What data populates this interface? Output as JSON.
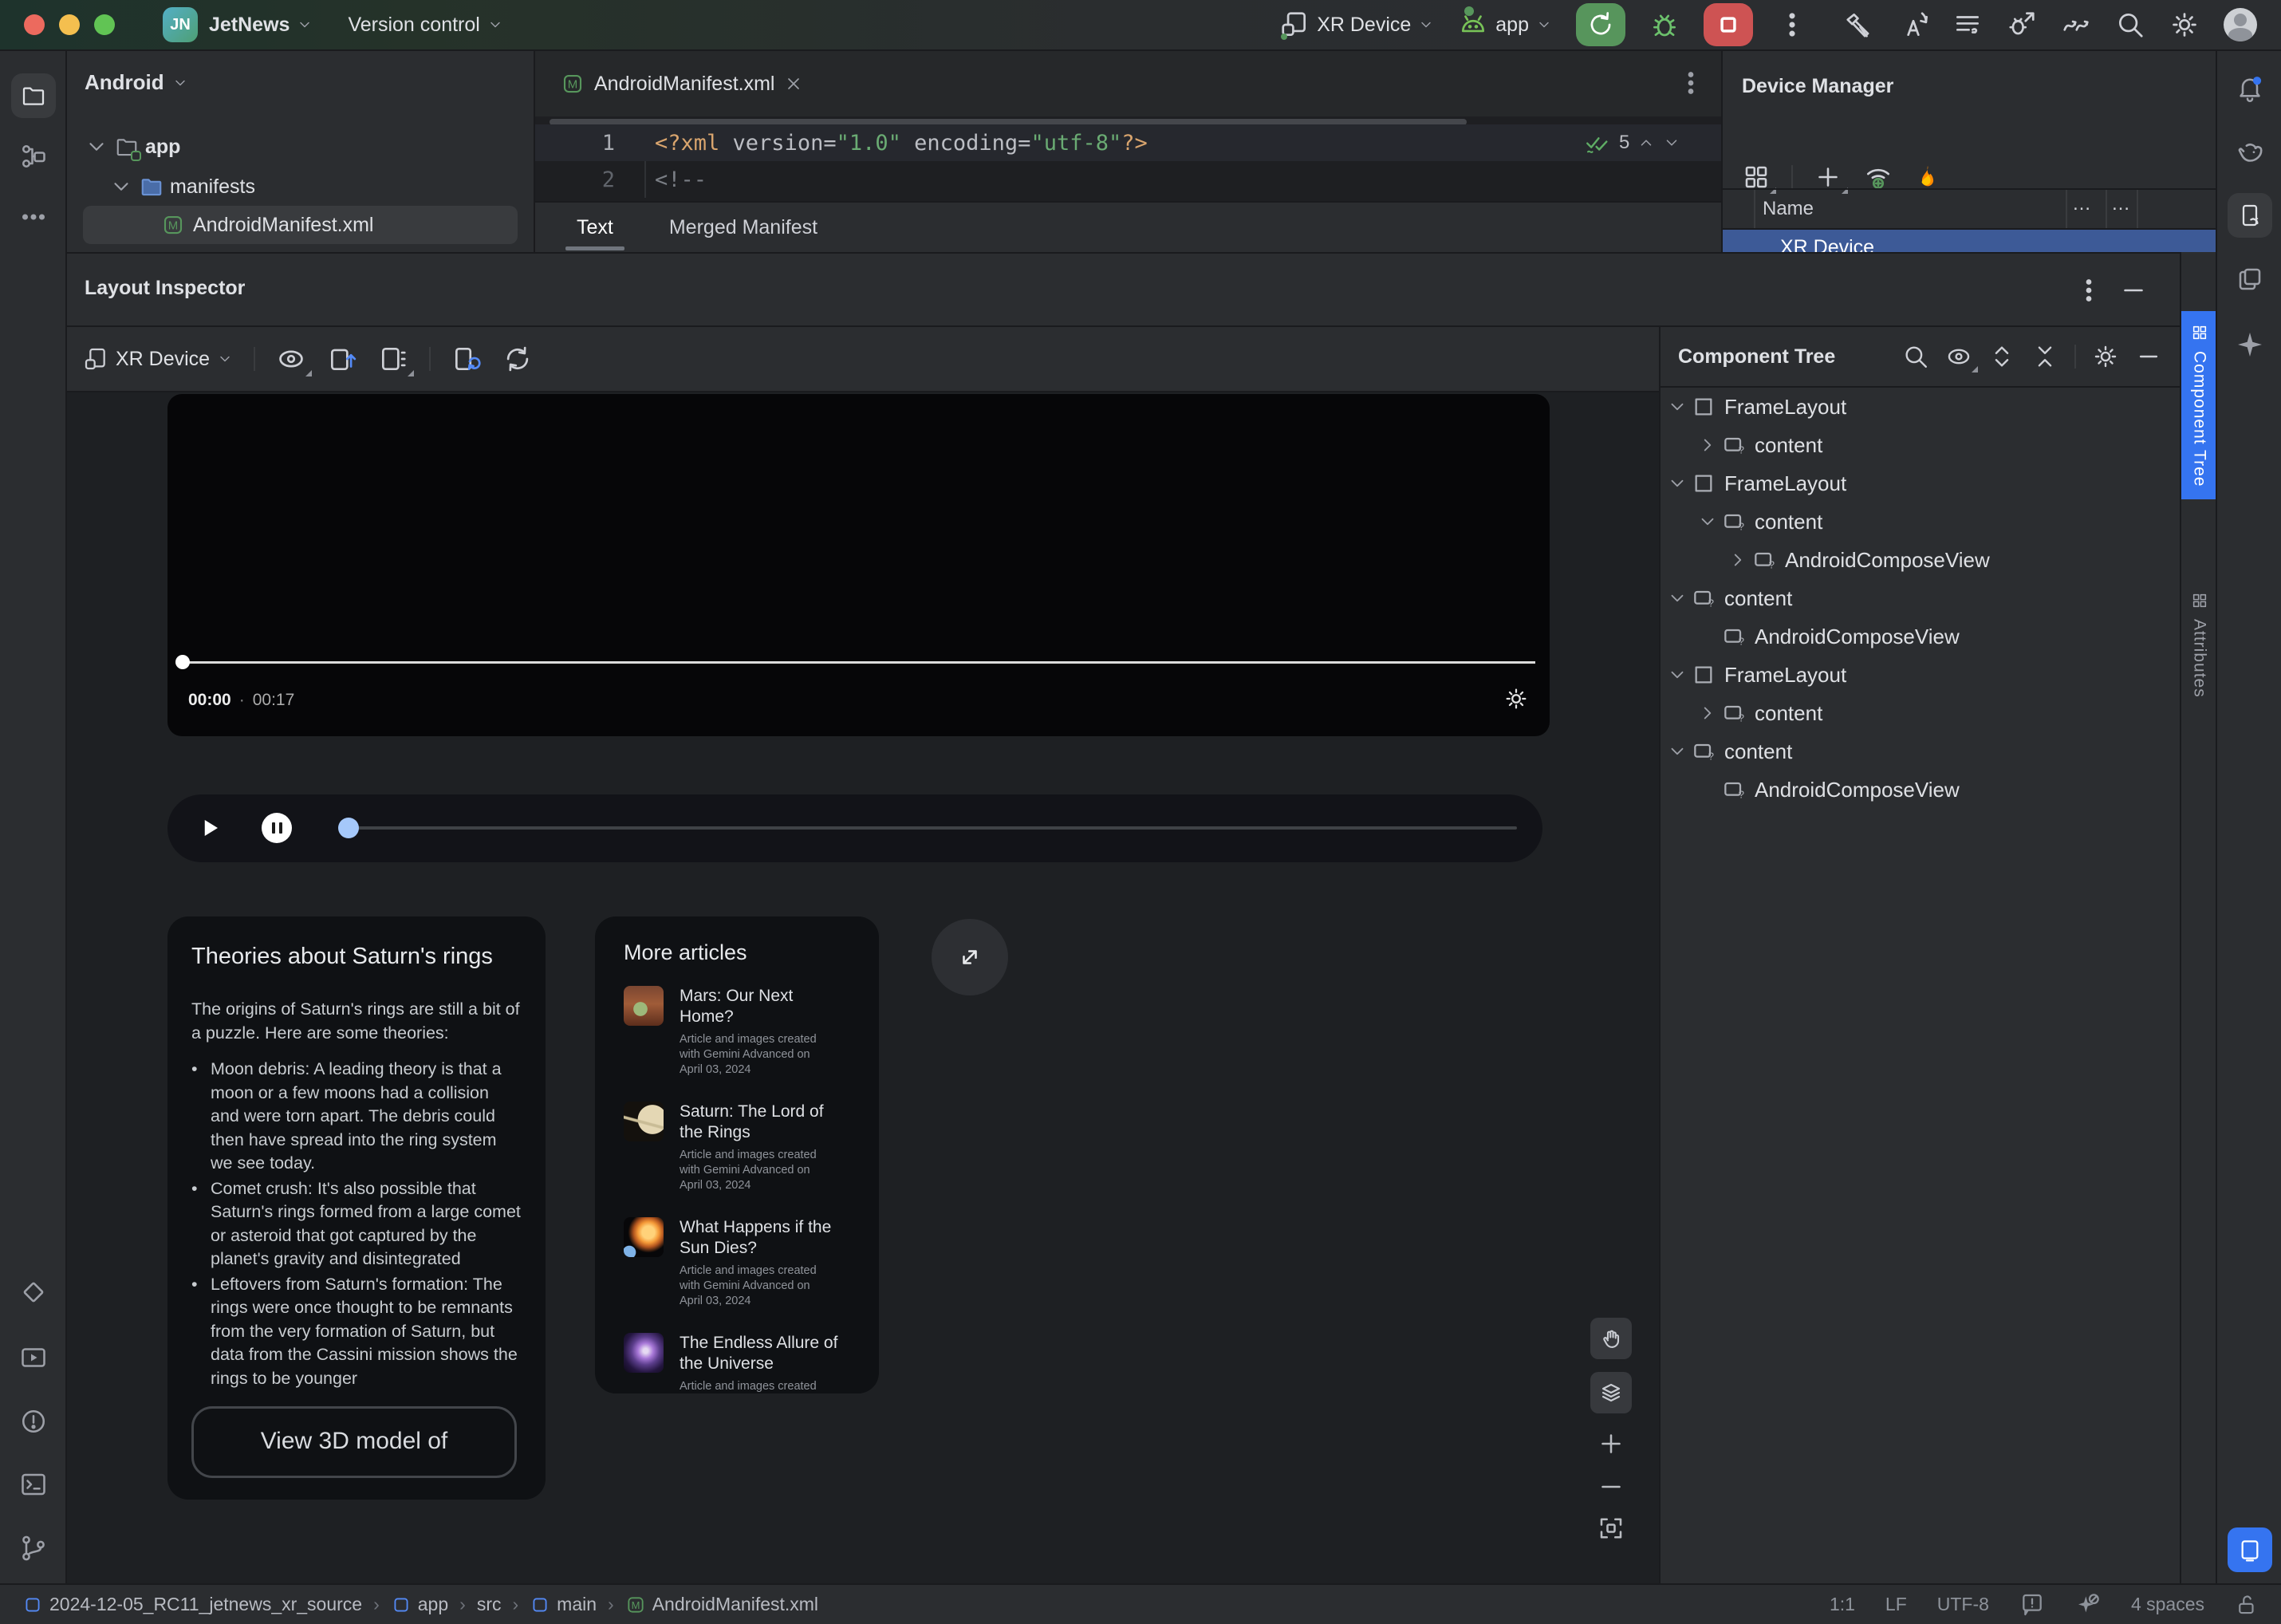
{
  "titlebar": {
    "logo": "JN",
    "project_name": "JetNews",
    "menu": "Version control",
    "target_device": "XR Device",
    "run_config": "app"
  },
  "project_panel": {
    "view_selector": "Android",
    "nodes": {
      "app": "app",
      "manifests": "manifests",
      "manifest_file": "AndroidManifest.xml"
    }
  },
  "editor": {
    "tab_title": "AndroidManifest.xml",
    "line1": {
      "num": "1",
      "tokens": [
        {
          "t": "<?xml",
          "c": "tag"
        },
        {
          "t": " version=",
          "c": "attr"
        },
        {
          "t": "\"1.0\"",
          "c": "str"
        },
        {
          "t": " encoding=",
          "c": "attr"
        },
        {
          "t": "\"utf-8\"",
          "c": "str"
        },
        {
          "t": "?>",
          "c": "tag"
        }
      ]
    },
    "line2": {
      "num": "2",
      "tokens": [
        {
          "t": "<!--",
          "c": "cmt"
        }
      ]
    },
    "inspections_count": "5",
    "subtab_text": "Text",
    "subtab_merged": "Merged Manifest"
  },
  "device_manager": {
    "title": "Device Manager",
    "col_name": "Name",
    "col_more1": "…",
    "col_more2": "…",
    "selected_device": "XR Device"
  },
  "layout_inspector": {
    "title": "Layout Inspector",
    "process": "XR Device"
  },
  "component_tree": {
    "title": "Component Tree",
    "nodes": [
      {
        "label": "FrameLayout",
        "cls": "lvl0 exp frame"
      },
      {
        "label": "content",
        "cls": "lvl1 col view"
      },
      {
        "label": "FrameLayout",
        "cls": "lvl0 exp frame"
      },
      {
        "label": "content",
        "cls": "lvl1 exp view"
      },
      {
        "label": "AndroidComposeView",
        "cls": "lvl2 col view"
      },
      {
        "label": "content",
        "cls": "lvl0 exp view"
      },
      {
        "label": "AndroidComposeView",
        "cls": "lvl1 none view"
      },
      {
        "label": "FrameLayout",
        "cls": "lvl0 exp frame"
      },
      {
        "label": "content",
        "cls": "lvl1 col view"
      },
      {
        "label": "content",
        "cls": "lvl0 exp view"
      },
      {
        "label": "AndroidComposeView",
        "cls": "lvl1 none view"
      }
    ]
  },
  "side_tabs": {
    "component_tree": "Component Tree",
    "attributes": "Attributes"
  },
  "app_screen": {
    "video": {
      "elapsed": "00:00",
      "separator": "·",
      "duration": "00:17"
    },
    "theories_card": {
      "title": "Theories about Saturn's rings",
      "intro": "The origins of Saturn's rings are still a bit of a puzzle. Here are some theories:",
      "bullets": [
        {
          "marker": "•",
          "text": "Moon debris: A leading theory is that a moon or a few moons had a collision and were torn apart. The debris could then have spread into the ring system we see today."
        },
        {
          "marker": "•",
          "text": "Comet crush: It's also possible that Saturn's rings formed from a large comet or asteroid that got captured by the planet's gravity and disintegrated"
        },
        {
          "marker": "•",
          "text": "Leftovers from Saturn's formation: The rings were once thought to be remnants from the very formation of Saturn, but data from the Cassini mission shows the rings to be younger"
        }
      ],
      "button_label": "View 3D model of"
    },
    "articles_card": {
      "title": "More articles",
      "items": [
        {
          "title": "Mars: Our Next Home?",
          "sub": "Article and images created with Gemini Advanced on April 03, 2024",
          "thumb": "th-mars"
        },
        {
          "title": "Saturn: The Lord of the Rings",
          "sub": "Article and images created with Gemini Advanced on April 03, 2024",
          "thumb": "th-saturn"
        },
        {
          "title": "What Happens if the Sun Dies?",
          "sub": "Article and images created with Gemini Advanced on April 03, 2024",
          "thumb": "th-sun"
        },
        {
          "title": "The Endless Allure of the Universe",
          "sub": "Article and images created with Gemini Advanced on",
          "thumb": "th-universe"
        }
      ]
    }
  },
  "status_bar": {
    "crumbs": [
      {
        "label": "2024-12-05_RC11_jetnews_xr_source",
        "icon": "module"
      },
      {
        "label": "›",
        "icon": "sep"
      },
      {
        "label": "app",
        "icon": "module"
      },
      {
        "label": "›",
        "icon": "sep"
      },
      {
        "label": "src",
        "icon": "plain"
      },
      {
        "label": "›",
        "icon": "sep"
      },
      {
        "label": "main",
        "icon": "module"
      },
      {
        "label": "›",
        "icon": "sep"
      },
      {
        "label": "AndroidManifest.xml",
        "icon": "manifest"
      }
    ],
    "caret_position": "1:1",
    "line_separator": "LF",
    "encoding": "UTF-8",
    "indent": "4 spaces"
  }
}
